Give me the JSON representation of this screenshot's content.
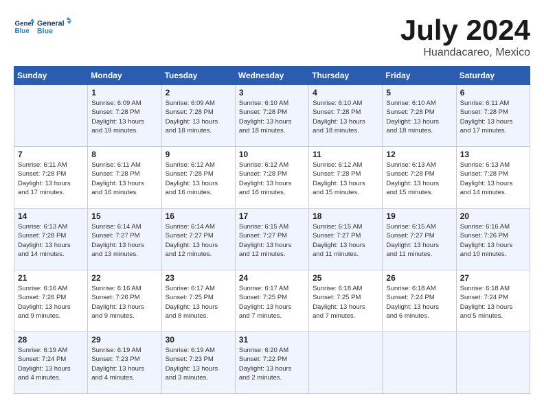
{
  "header": {
    "logo_line1": "General",
    "logo_line2": "Blue",
    "month": "July 2024",
    "location": "Huandacareo, Mexico"
  },
  "days_of_week": [
    "Sunday",
    "Monday",
    "Tuesday",
    "Wednesday",
    "Thursday",
    "Friday",
    "Saturday"
  ],
  "weeks": [
    [
      {
        "day": "",
        "info": ""
      },
      {
        "day": "1",
        "info": "Sunrise: 6:09 AM\nSunset: 7:28 PM\nDaylight: 13 hours\nand 19 minutes."
      },
      {
        "day": "2",
        "info": "Sunrise: 6:09 AM\nSunset: 7:28 PM\nDaylight: 13 hours\nand 18 minutes."
      },
      {
        "day": "3",
        "info": "Sunrise: 6:10 AM\nSunset: 7:28 PM\nDaylight: 13 hours\nand 18 minutes."
      },
      {
        "day": "4",
        "info": "Sunrise: 6:10 AM\nSunset: 7:28 PM\nDaylight: 13 hours\nand 18 minutes."
      },
      {
        "day": "5",
        "info": "Sunrise: 6:10 AM\nSunset: 7:28 PM\nDaylight: 13 hours\nand 18 minutes."
      },
      {
        "day": "6",
        "info": "Sunrise: 6:11 AM\nSunset: 7:28 PM\nDaylight: 13 hours\nand 17 minutes."
      }
    ],
    [
      {
        "day": "7",
        "info": "Sunrise: 6:11 AM\nSunset: 7:28 PM\nDaylight: 13 hours\nand 17 minutes."
      },
      {
        "day": "8",
        "info": "Sunrise: 6:11 AM\nSunset: 7:28 PM\nDaylight: 13 hours\nand 16 minutes."
      },
      {
        "day": "9",
        "info": "Sunrise: 6:12 AM\nSunset: 7:28 PM\nDaylight: 13 hours\nand 16 minutes."
      },
      {
        "day": "10",
        "info": "Sunrise: 6:12 AM\nSunset: 7:28 PM\nDaylight: 13 hours\nand 16 minutes."
      },
      {
        "day": "11",
        "info": "Sunrise: 6:12 AM\nSunset: 7:28 PM\nDaylight: 13 hours\nand 15 minutes."
      },
      {
        "day": "12",
        "info": "Sunrise: 6:13 AM\nSunset: 7:28 PM\nDaylight: 13 hours\nand 15 minutes."
      },
      {
        "day": "13",
        "info": "Sunrise: 6:13 AM\nSunset: 7:28 PM\nDaylight: 13 hours\nand 14 minutes."
      }
    ],
    [
      {
        "day": "14",
        "info": "Sunrise: 6:13 AM\nSunset: 7:28 PM\nDaylight: 13 hours\nand 14 minutes."
      },
      {
        "day": "15",
        "info": "Sunrise: 6:14 AM\nSunset: 7:27 PM\nDaylight: 13 hours\nand 13 minutes."
      },
      {
        "day": "16",
        "info": "Sunrise: 6:14 AM\nSunset: 7:27 PM\nDaylight: 13 hours\nand 12 minutes."
      },
      {
        "day": "17",
        "info": "Sunrise: 6:15 AM\nSunset: 7:27 PM\nDaylight: 13 hours\nand 12 minutes."
      },
      {
        "day": "18",
        "info": "Sunrise: 6:15 AM\nSunset: 7:27 PM\nDaylight: 13 hours\nand 11 minutes."
      },
      {
        "day": "19",
        "info": "Sunrise: 6:15 AM\nSunset: 7:27 PM\nDaylight: 13 hours\nand 11 minutes."
      },
      {
        "day": "20",
        "info": "Sunrise: 6:16 AM\nSunset: 7:26 PM\nDaylight: 13 hours\nand 10 minutes."
      }
    ],
    [
      {
        "day": "21",
        "info": "Sunrise: 6:16 AM\nSunset: 7:26 PM\nDaylight: 13 hours\nand 9 minutes."
      },
      {
        "day": "22",
        "info": "Sunrise: 6:16 AM\nSunset: 7:26 PM\nDaylight: 13 hours\nand 9 minutes."
      },
      {
        "day": "23",
        "info": "Sunrise: 6:17 AM\nSunset: 7:25 PM\nDaylight: 13 hours\nand 8 minutes."
      },
      {
        "day": "24",
        "info": "Sunrise: 6:17 AM\nSunset: 7:25 PM\nDaylight: 13 hours\nand 7 minutes."
      },
      {
        "day": "25",
        "info": "Sunrise: 6:18 AM\nSunset: 7:25 PM\nDaylight: 13 hours\nand 7 minutes."
      },
      {
        "day": "26",
        "info": "Sunrise: 6:18 AM\nSunset: 7:24 PM\nDaylight: 13 hours\nand 6 minutes."
      },
      {
        "day": "27",
        "info": "Sunrise: 6:18 AM\nSunset: 7:24 PM\nDaylight: 13 hours\nand 5 minutes."
      }
    ],
    [
      {
        "day": "28",
        "info": "Sunrise: 6:19 AM\nSunset: 7:24 PM\nDaylight: 13 hours\nand 4 minutes."
      },
      {
        "day": "29",
        "info": "Sunrise: 6:19 AM\nSunset: 7:23 PM\nDaylight: 13 hours\nand 4 minutes."
      },
      {
        "day": "30",
        "info": "Sunrise: 6:19 AM\nSunset: 7:23 PM\nDaylight: 13 hours\nand 3 minutes."
      },
      {
        "day": "31",
        "info": "Sunrise: 6:20 AM\nSunset: 7:22 PM\nDaylight: 13 hours\nand 2 minutes."
      },
      {
        "day": "",
        "info": ""
      },
      {
        "day": "",
        "info": ""
      },
      {
        "day": "",
        "info": ""
      }
    ]
  ]
}
